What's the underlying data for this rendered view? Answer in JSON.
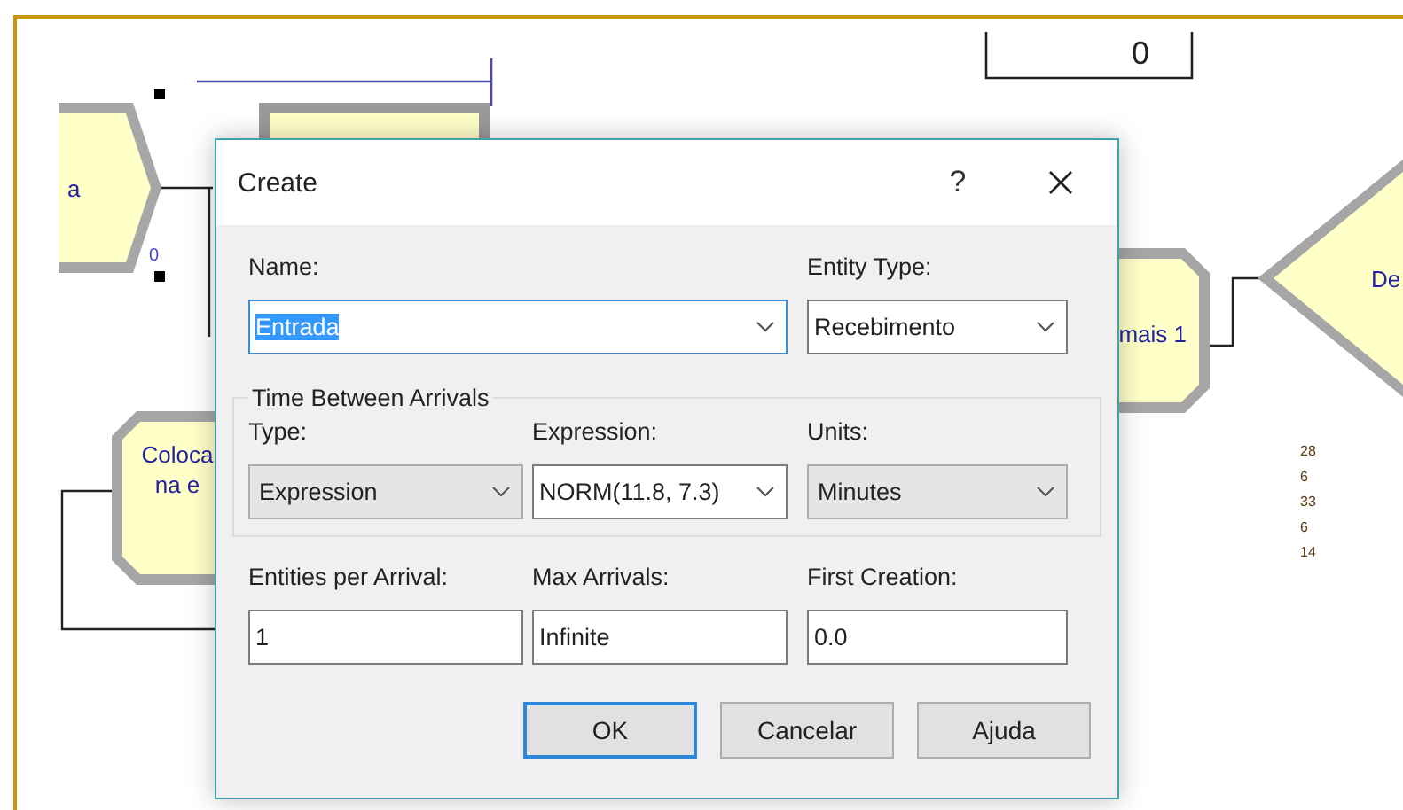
{
  "canvas": {
    "nodes": [
      {
        "kind": "create",
        "lines": [
          "a"
        ],
        "badge": "0"
      },
      {
        "kind": "process",
        "lines": [
          "Coloca",
          "na e"
        ]
      },
      {
        "kind": "process",
        "lines": [
          "mais 1"
        ]
      },
      {
        "kind": "decide",
        "lines": [
          "De"
        ]
      }
    ],
    "counter": "0",
    "stats": [
      "28",
      "6",
      "33",
      "6",
      "14"
    ]
  },
  "dialog": {
    "title": "Create",
    "help": "?",
    "rows": [
      {
        "fields": [
          {
            "label": "Name:",
            "value": "Entrada",
            "kind": "combo",
            "focused": true
          },
          {
            "label": "Entity Type:",
            "value": "Recebimento",
            "kind": "combo",
            "focused": false
          }
        ]
      },
      {
        "group": "Time Between Arrivals",
        "fields": [
          {
            "label": "Type:",
            "value": "Expression",
            "kind": "dropdown",
            "focused": false
          },
          {
            "label": "Expression:",
            "value": "NORM(11.8, 7.3)",
            "kind": "combo",
            "focused": false
          },
          {
            "label": "Units:",
            "value": "Minutes",
            "kind": "dropdown",
            "focused": false
          }
        ]
      },
      {
        "fields": [
          {
            "label": "Entities per Arrival:",
            "value": "1",
            "kind": "text",
            "focused": false
          },
          {
            "label": "Max Arrivals:",
            "value": "Infinite",
            "kind": "text",
            "focused": false
          },
          {
            "label": "First Creation:",
            "value": "0.0",
            "kind": "text",
            "focused": false
          }
        ]
      }
    ],
    "buttons": [
      {
        "label": "OK",
        "default": true
      },
      {
        "label": "Cancelar",
        "default": false
      },
      {
        "label": "Ajuda",
        "default": false
      }
    ]
  }
}
